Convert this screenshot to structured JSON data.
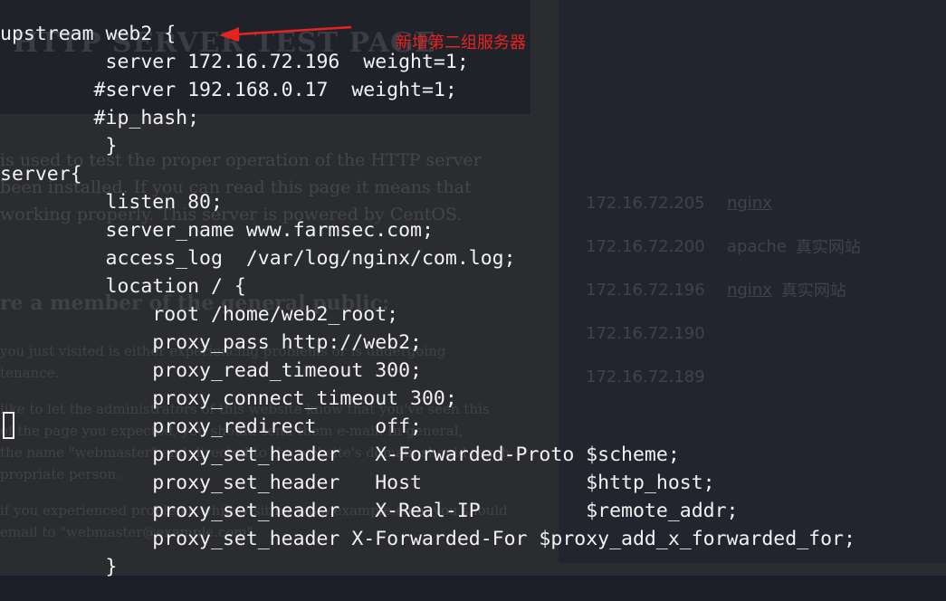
{
  "background_page": {
    "title": "HTTP SERVER TEST PAGE",
    "paragraph_lines": [
      "is used to test the proper operation of the HTTP server",
      "been installed. If you can read this page it means that",
      "working properly. This server is powered by CentOS."
    ],
    "paragraph_link": "CentOS",
    "subheading": "re a member of the general public:",
    "small_lines_1": [
      "you just visited is either experiencing problems or is undergoing",
      "tenance."
    ],
    "small_lines_2": [
      "like to let the administrators of this website know that you've seen this",
      "of the page you expected, you should send them e-mail. In general,",
      "the name \"webmaster\" and directed to the website's domain should reach",
      "propriate person."
    ],
    "small_lines_3": [
      "if you experienced problems while visiting www.example.com, you should",
      "email to \"webmaster@example.com\"."
    ]
  },
  "right_list": [
    {
      "ip": "172.16.72.205",
      "name": "nginx",
      "note": "",
      "underline": true
    },
    {
      "ip": "172.16.72.200",
      "name": "apache",
      "note": "真实网站",
      "underline": false
    },
    {
      "ip": "172.16.72.196",
      "name": "nginx",
      "note": "真实网站",
      "underline": true
    },
    {
      "ip": "172.16.72.190",
      "name": "",
      "note": "",
      "underline": false
    },
    {
      "ip": "172.16.72.189",
      "name": "",
      "note": "",
      "underline": false
    }
  ],
  "annotation": {
    "text": "新增第二组服务器",
    "color": "#e8231f"
  },
  "code_lines": [
    "upstream web2 {",
    "         server 172.16.72.196  weight=1;",
    "        #server 192.168.0.17  weight=1;",
    "        #ip_hash;",
    "         }",
    "server{",
    "         listen 80;",
    "         server_name www.farmsec.com;",
    "         access_log  /var/log/nginx/com.log;",
    "         location / {",
    "             root /home/web2_root;",
    "             proxy_pass http://web2;",
    "             proxy_read_timeout 300;",
    "             proxy_connect_timeout 300;",
    "             proxy_redirect     off;",
    "             proxy_set_header   X-Forwarded-Proto $scheme;",
    "             proxy_set_header   Host              $http_host;",
    "             proxy_set_header   X-Real-IP         $remote_addr;",
    "             proxy_set_header X-Forwarded-For $proxy_add_x_forwarded_for;",
    "         }"
  ],
  "colors": {
    "terminal_text": "#f2f2f2",
    "page_background": "#1d2129"
  }
}
